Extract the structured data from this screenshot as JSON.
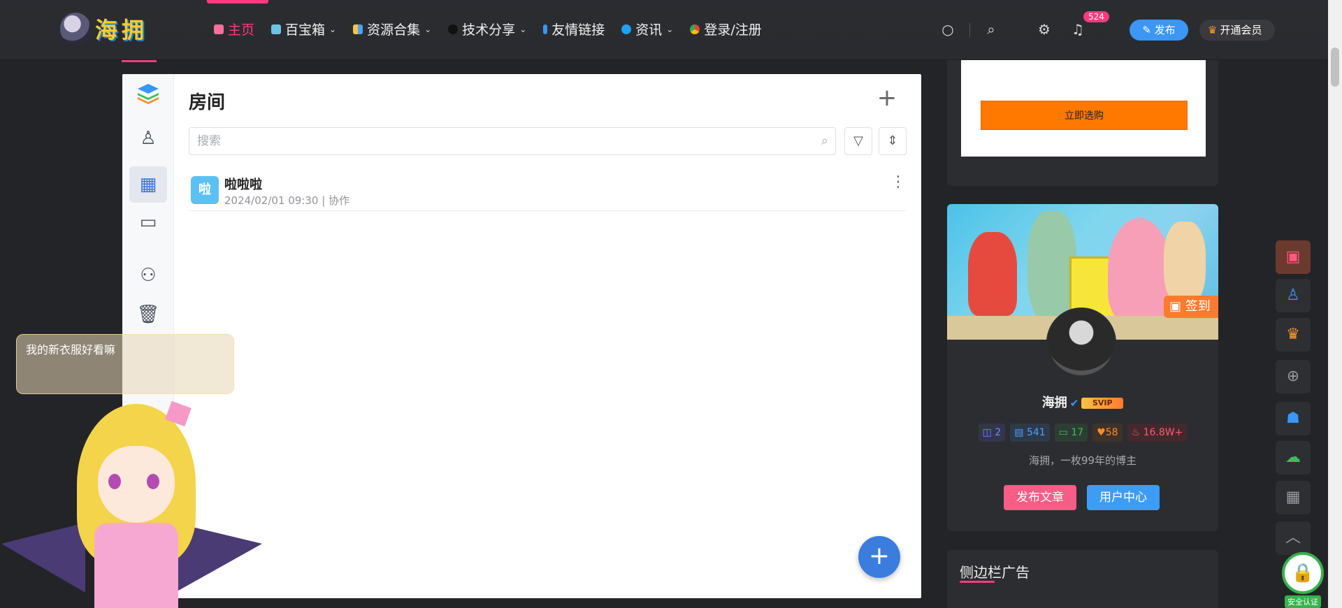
{
  "header": {
    "logo_text": "海拥",
    "nav": [
      {
        "label": "主页",
        "active": true,
        "icon": "home-icon",
        "dropdown": false
      },
      {
        "label": "百宝箱",
        "active": false,
        "icon": "toolbox-icon",
        "dropdown": true
      },
      {
        "label": "资源合集",
        "active": false,
        "icon": "grid-icon",
        "dropdown": true
      },
      {
        "label": "技术分享",
        "active": false,
        "icon": "github-icon",
        "dropdown": true
      },
      {
        "label": "友情链接",
        "active": false,
        "icon": "pen-icon",
        "dropdown": false
      },
      {
        "label": "资讯",
        "active": false,
        "icon": "twitter-icon",
        "dropdown": true
      },
      {
        "label": "登录/注册",
        "active": false,
        "icon": "chrome-icon",
        "dropdown": false
      }
    ],
    "notification_count": "524",
    "publish_label": "发布",
    "vip_label": "开通会员"
  },
  "rooms": {
    "title": "房间",
    "search_placeholder": "搜索",
    "items": [
      {
        "avatar": "啦",
        "name": "啦啦啦",
        "meta": "2024/02/01 09:30 | 协作"
      }
    ]
  },
  "ad": {
    "buy_label": "立即选购"
  },
  "profile": {
    "signin_label": "签到",
    "name": "海拥",
    "vip_badge": "SVIP",
    "stats": [
      {
        "icon": "chat-icon",
        "value": "2",
        "color": "#6b8cff",
        "bg": "#33364a"
      },
      {
        "icon": "file-icon",
        "value": "541",
        "color": "#4aa3ff",
        "bg": "#2e3a4a"
      },
      {
        "icon": "comment-icon",
        "value": "17",
        "color": "#34c25d",
        "bg": "#2e3d33"
      },
      {
        "icon": "heart-icon",
        "value": "58",
        "color": "#ff8a2e",
        "bg": "#3e3229"
      },
      {
        "icon": "fire-icon",
        "value": "16.8W+",
        "color": "#ff5a6e",
        "bg": "#42292e"
      }
    ],
    "description": "海拥，一枚99年的博主",
    "publish_article_label": "发布文章",
    "user_center_label": "用户中心"
  },
  "sidebar_ad": {
    "title": "侧边栏广告"
  },
  "mascot": {
    "bubble_text": "我的新衣服好看嘛"
  },
  "ssl": {
    "label": "安全认证"
  }
}
